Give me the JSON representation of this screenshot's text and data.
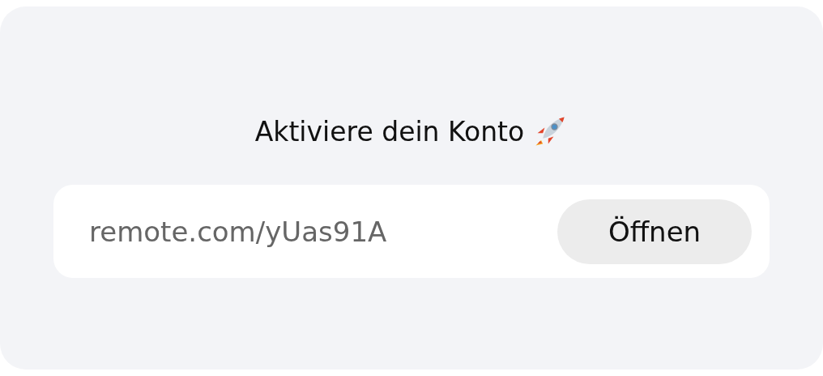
{
  "title": "Aktiviere dein Konto",
  "link": {
    "value": "remote.com/yUas91A"
  },
  "button": {
    "label": "Öffnen"
  }
}
